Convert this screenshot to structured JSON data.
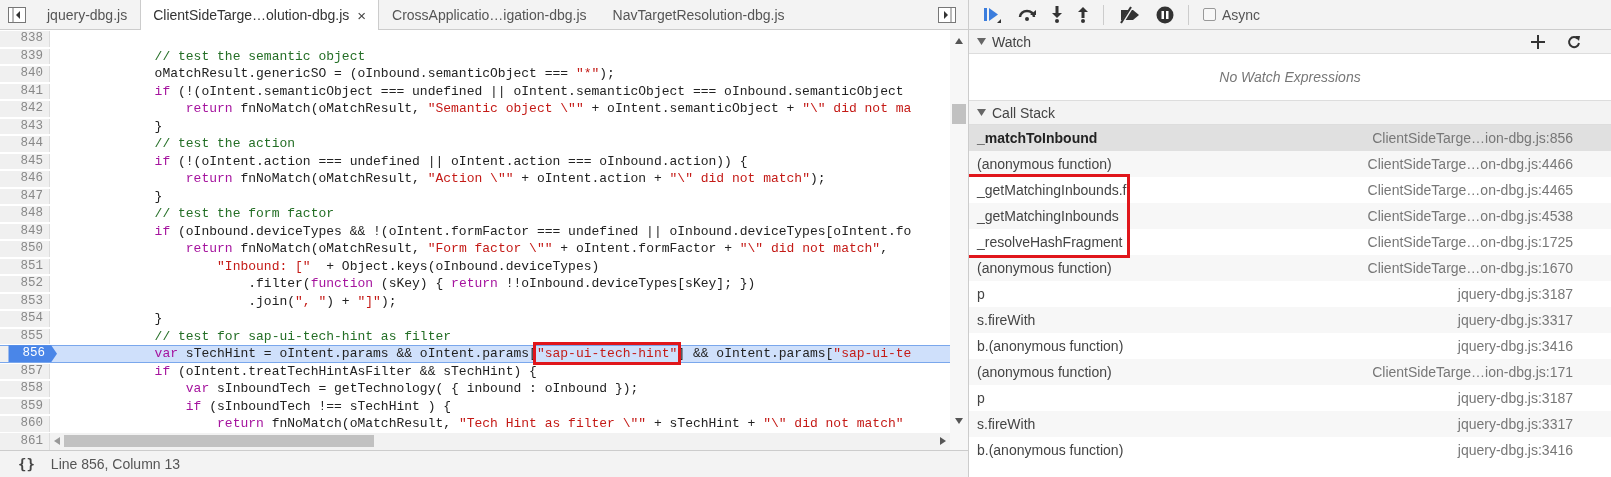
{
  "editor": {
    "tabs": [
      {
        "label": "jquery-dbg.js",
        "selected": false,
        "closable": false
      },
      {
        "label": "ClientSideTarge…olution-dbg.js",
        "selected": true,
        "closable": true
      },
      {
        "label": "CrossApplicatio…igation-dbg.js",
        "selected": false,
        "closable": false
      },
      {
        "label": "NavTargetResolution-dbg.js",
        "selected": false,
        "closable": false
      }
    ],
    "close_glyph": "×",
    "lines": [
      {
        "number": "838",
        "current": false
      },
      {
        "number": "839",
        "current": false,
        "segments": [
          {
            "kind": "comment",
            "text": "            // test the semantic object"
          }
        ]
      },
      {
        "number": "840",
        "current": false,
        "segments": [
          {
            "kind": "plain",
            "text": "            oMatchResult.genericSO = (oInbound.semanticObject === "
          },
          {
            "kind": "string",
            "text": "\"*\""
          },
          {
            "kind": "plain",
            "text": ");"
          }
        ]
      },
      {
        "number": "841",
        "current": false,
        "segments": [
          {
            "kind": "keyword",
            "text": "            if"
          },
          {
            "kind": "plain",
            "text": " (!(oIntent.semanticObject === undefined || oIntent.semanticObject === oInbound.semanticObject"
          }
        ]
      },
      {
        "number": "842",
        "current": false,
        "segments": [
          {
            "kind": "keyword",
            "text": "                return"
          },
          {
            "kind": "plain",
            "text": " fnNoMatch(oMatchResult, "
          },
          {
            "kind": "string",
            "text": "\"Semantic object \\\"\""
          },
          {
            "kind": "plain",
            "text": " + oIntent.semanticObject + "
          },
          {
            "kind": "string",
            "text": "\"\\\" did not ma"
          }
        ]
      },
      {
        "number": "843",
        "current": false,
        "segments": [
          {
            "kind": "plain",
            "text": "            }"
          }
        ]
      },
      {
        "number": "844",
        "current": false,
        "segments": [
          {
            "kind": "comment",
            "text": "            // test the action"
          }
        ]
      },
      {
        "number": "845",
        "current": false,
        "segments": [
          {
            "kind": "keyword",
            "text": "            if"
          },
          {
            "kind": "plain",
            "text": " (!(oIntent.action === undefined || oIntent.action === oInbound.action)) {"
          }
        ]
      },
      {
        "number": "846",
        "current": false,
        "segments": [
          {
            "kind": "keyword",
            "text": "                return"
          },
          {
            "kind": "plain",
            "text": " fnNoMatch(oMatchResult, "
          },
          {
            "kind": "string",
            "text": "\"Action \\\"\""
          },
          {
            "kind": "plain",
            "text": " + oIntent.action + "
          },
          {
            "kind": "string",
            "text": "\"\\\" did not match\""
          },
          {
            "kind": "plain",
            "text": ");"
          }
        ]
      },
      {
        "number": "847",
        "current": false,
        "segments": [
          {
            "kind": "plain",
            "text": "            }"
          }
        ]
      },
      {
        "number": "848",
        "current": false,
        "segments": [
          {
            "kind": "comment",
            "text": "            // test the form factor"
          }
        ]
      },
      {
        "number": "849",
        "current": false,
        "segments": [
          {
            "kind": "keyword",
            "text": "            if"
          },
          {
            "kind": "plain",
            "text": " (oInbound.deviceTypes && !(oIntent.formFactor === undefined || oInbound.deviceTypes[oIntent.fo"
          }
        ]
      },
      {
        "number": "850",
        "current": false,
        "segments": [
          {
            "kind": "keyword",
            "text": "                return"
          },
          {
            "kind": "plain",
            "text": " fnNoMatch(oMatchResult, "
          },
          {
            "kind": "string",
            "text": "\"Form factor \\\"\""
          },
          {
            "kind": "plain",
            "text": " + oIntent.formFactor + "
          },
          {
            "kind": "string",
            "text": "\"\\\" did not match\""
          },
          {
            "kind": "plain",
            "text": ","
          }
        ]
      },
      {
        "number": "851",
        "current": false,
        "segments": [
          {
            "kind": "string",
            "text": "                    \"Inbound: [\""
          },
          {
            "kind": "plain",
            "text": "  + Object.keys(oInbound.deviceTypes)"
          }
        ]
      },
      {
        "number": "852",
        "current": false,
        "segments": [
          {
            "kind": "plain",
            "text": "                        .filter("
          },
          {
            "kind": "keyword",
            "text": "function"
          },
          {
            "kind": "plain",
            "text": " (sKey) { "
          },
          {
            "kind": "keyword",
            "text": "return"
          },
          {
            "kind": "plain",
            "text": " !!oInbound.deviceTypes[sKey]; })"
          }
        ]
      },
      {
        "number": "853",
        "current": false,
        "segments": [
          {
            "kind": "plain",
            "text": "                        .join("
          },
          {
            "kind": "string",
            "text": "\", \""
          },
          {
            "kind": "plain",
            "text": ") + "
          },
          {
            "kind": "string",
            "text": "\"]\""
          },
          {
            "kind": "plain",
            "text": ");"
          }
        ]
      },
      {
        "number": "854",
        "current": false,
        "segments": [
          {
            "kind": "plain",
            "text": "            }"
          }
        ]
      },
      {
        "number": "855",
        "current": false,
        "segments": [
          {
            "kind": "comment",
            "text": "            // test for sap-ui-tech-hint as filter"
          }
        ]
      },
      {
        "number": "856",
        "current": true,
        "segments": [
          {
            "kind": "keyword",
            "text": "            var"
          },
          {
            "kind": "plain",
            "text": " sTechHint = oIntent.params && oIntent.params["
          },
          {
            "kind": "string",
            "text": "\"sap-ui-tech-hint\"",
            "boxed": true
          },
          {
            "kind": "plain",
            "text": "] && oIntent.params["
          },
          {
            "kind": "string",
            "text": "\"sap-ui-te"
          }
        ]
      },
      {
        "number": "857",
        "current": false,
        "segments": [
          {
            "kind": "keyword",
            "text": "            if"
          },
          {
            "kind": "plain",
            "text": " (oIntent.treatTechHintAsFilter && sTechHint) {"
          }
        ]
      },
      {
        "number": "858",
        "current": false,
        "segments": [
          {
            "kind": "keyword",
            "text": "                var"
          },
          {
            "kind": "plain",
            "text": " sInboundTech = getTechnology( { inbound : oInbound });"
          }
        ]
      },
      {
        "number": "859",
        "current": false,
        "segments": [
          {
            "kind": "keyword",
            "text": "                if"
          },
          {
            "kind": "plain",
            "text": " (sInboundTech !== sTechHint ) {"
          }
        ]
      },
      {
        "number": "860",
        "current": false,
        "segments": [
          {
            "kind": "keyword",
            "text": "                    return"
          },
          {
            "kind": "plain",
            "text": " fnNoMatch(oMatchResult, "
          },
          {
            "kind": "string",
            "text": "\"Tech Hint as filter \\\"\""
          },
          {
            "kind": "plain",
            "text": " + sTechHint + "
          },
          {
            "kind": "string",
            "text": "\"\\\" did not match\""
          }
        ]
      }
    ],
    "scroll_row_number": "861",
    "status_bar": {
      "format_button": "{}",
      "position": "Line 856, Column 13"
    }
  },
  "debugger": {
    "async": {
      "label": "Async",
      "checked": false
    },
    "watch": {
      "title": "Watch",
      "expanded": true,
      "empty_message": "No Watch Expressions"
    },
    "call_stack": {
      "title": "Call Stack",
      "expanded": true,
      "frames": [
        {
          "name": "_matchToInbound",
          "location": "ClientSideTarge…ion-dbg.js:856",
          "selected": true,
          "boxed": false
        },
        {
          "name": "(anonymous function)",
          "location": "ClientSideTarge…on-dbg.js:4466",
          "selected": false,
          "boxed": false
        },
        {
          "name": "_getMatchingInbounds.f",
          "location": "ClientSideTarge…on-dbg.js:4465",
          "selected": false,
          "boxed": true
        },
        {
          "name": "_getMatchingInbounds",
          "location": "ClientSideTarge…on-dbg.js:4538",
          "selected": false,
          "boxed": true
        },
        {
          "name": "_resolveHashFragment",
          "location": "ClientSideTarge…on-dbg.js:1725",
          "selected": false,
          "boxed": true
        },
        {
          "name": "(anonymous function)",
          "location": "ClientSideTarge…on-dbg.js:1670",
          "selected": false,
          "boxed": false
        },
        {
          "name": "p",
          "location": "jquery-dbg.js:3187",
          "selected": false,
          "boxed": false
        },
        {
          "name": "s.fireWith",
          "location": "jquery-dbg.js:3317",
          "selected": false,
          "boxed": false
        },
        {
          "name": "b.(anonymous function)",
          "location": "jquery-dbg.js:3416",
          "selected": false,
          "boxed": false
        },
        {
          "name": "(anonymous function)",
          "location": "ClientSideTarge…ion-dbg.js:171",
          "selected": false,
          "boxed": false
        },
        {
          "name": "p",
          "location": "jquery-dbg.js:3187",
          "selected": false,
          "boxed": false
        },
        {
          "name": "s.fireWith",
          "location": "jquery-dbg.js:3317",
          "selected": false,
          "boxed": false
        },
        {
          "name": "b.(anonymous function)",
          "location": "jquery-dbg.js:3416",
          "selected": false,
          "boxed": false
        }
      ]
    }
  }
}
